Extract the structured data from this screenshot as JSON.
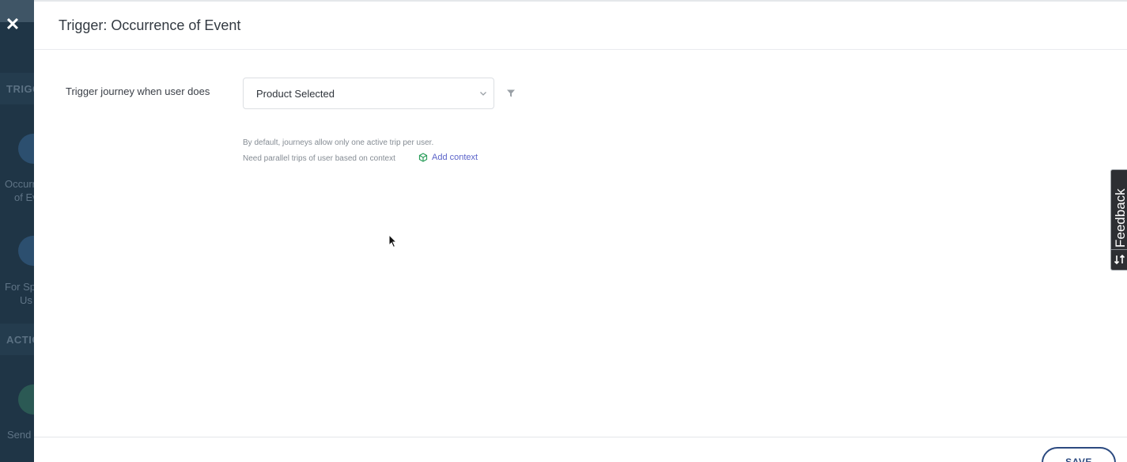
{
  "backdrop": {
    "section_triggers": "TRIGG",
    "item1_label_line1": "Occurr",
    "item1_label_line2": "of Ev",
    "item2_label_line1": "For Sp",
    "item2_label_line2": "Us",
    "section_actions": "ACTIO",
    "item3_label": "Send"
  },
  "drawer": {
    "title": "Trigger: Occurrence of Event",
    "field_label": "Trigger journey when user does",
    "select_value": "Product Selected",
    "hint_line1": "By default, journeys allow only one active trip per user.",
    "hint_line2": "Need parallel trips of user based on context",
    "add_context_label": "Add context",
    "save_label": "SAVE"
  },
  "feedback": {
    "label": "Feedback"
  },
  "colors": {
    "accent_link": "#5b63c9",
    "primary_button": "#2c4a80",
    "backdrop_dark": "#1f3546",
    "context_icon": "#2a9d5a"
  },
  "icons": [
    "close-icon",
    "chevron-down-icon",
    "filter-icon",
    "context-cube-icon",
    "feedback-icon"
  ]
}
